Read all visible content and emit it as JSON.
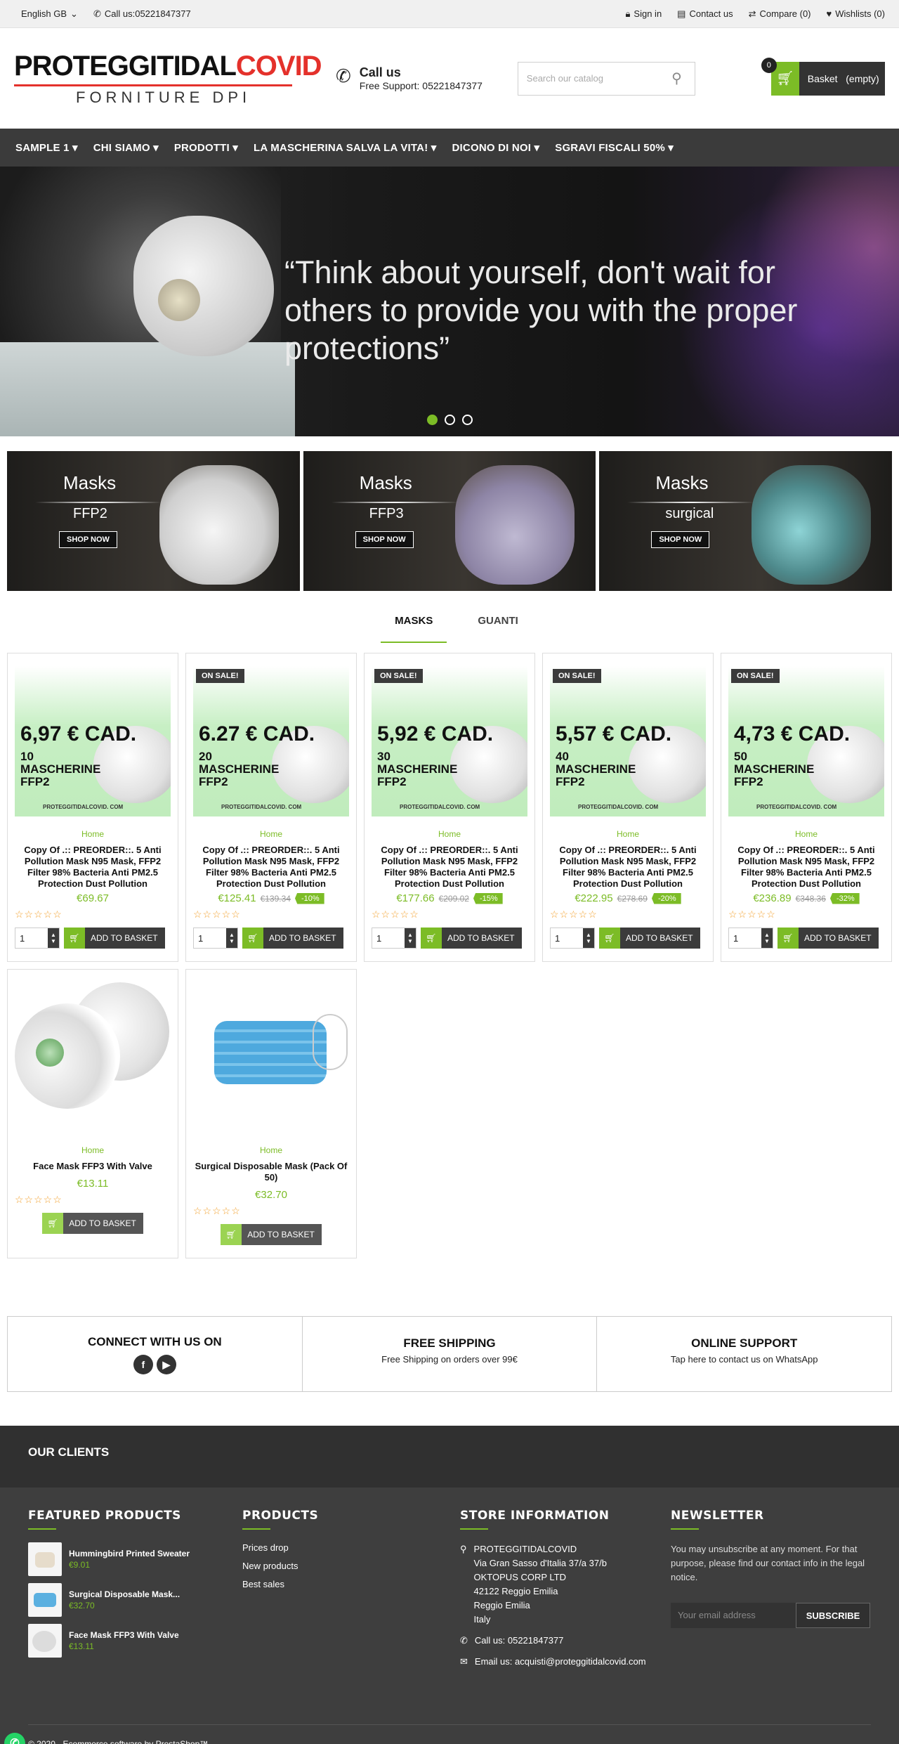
{
  "topbar": {
    "language": "English GB",
    "call": "Call us:05221847377",
    "signin": "Sign in",
    "contact": "Contact us",
    "compare": "Compare (0)",
    "wishlists": "Wishlists (0)"
  },
  "logo": {
    "line1a": "PROTEGGITIDAL",
    "line1b": "COVID",
    "line2": "FORNITURE DPI"
  },
  "header": {
    "call_title": "Call us",
    "call_sub": "Free Support: 05221847377",
    "search_placeholder": "Search our catalog",
    "basket_label": "Basket",
    "basket_state": "(empty)",
    "basket_count": "0"
  },
  "nav": [
    "SAMPLE 1",
    "CHI SIAMO",
    "PRODOTTI",
    "LA MASCHERINA SALVA LA VITA!",
    "DICONO DI NOI",
    "SGRAVI FISCALI 50%"
  ],
  "hero": {
    "quote": "“Think about yourself, don't wait for others to provide you with the proper protections”"
  },
  "banners": [
    {
      "title": "Masks",
      "sub": "FFP2",
      "btn": "SHOP NOW"
    },
    {
      "title": "Masks",
      "sub": "FFP3",
      "btn": "SHOP NOW"
    },
    {
      "title": "Masks",
      "sub": "surgical",
      "btn": "SHOP NOW"
    }
  ],
  "tabs": [
    "MASKS",
    "GUANTI"
  ],
  "products": [
    {
      "onsale": "",
      "promo_price": "6,97 € CAD.",
      "promo_qty1": "10",
      "promo_qty2": "MASCHERINE",
      "promo_qty3": "FFP2",
      "promo_site": "PROTEGGITIDALCOVID. COM",
      "cat": "Home",
      "name": "Copy Of .:: PREORDER::. 5 Anti Pollution Mask N95 Mask, FFP2 Filter 98% Bacteria Anti PM2.5 Protection Dust Pollution",
      "price": "€69.67",
      "old": "",
      "disc": ""
    },
    {
      "onsale": "ON SALE!",
      "promo_price": "6.27 € CAD.",
      "promo_qty1": "20",
      "promo_qty2": "MASCHERINE",
      "promo_qty3": "FFP2",
      "promo_site": "PROTEGGITIDALCOVID. COM",
      "cat": "Home",
      "name": "Copy Of .:: PREORDER::. 5 Anti Pollution Mask N95 Mask, FFP2 Filter 98% Bacteria Anti PM2.5 Protection Dust Pollution",
      "price": "€125.41",
      "old": "€139.34",
      "disc": "-10%"
    },
    {
      "onsale": "ON SALE!",
      "promo_price": "5,92 € CAD.",
      "promo_qty1": "30",
      "promo_qty2": "MASCHERINE",
      "promo_qty3": "FFP2",
      "promo_site": "PROTEGGITIDALCOVID. COM",
      "cat": "Home",
      "name": "Copy Of .:: PREORDER::. 5 Anti Pollution Mask N95 Mask, FFP2 Filter 98% Bacteria Anti PM2.5 Protection Dust Pollution",
      "price": "€177.66",
      "old": "€209.02",
      "disc": "-15%"
    },
    {
      "onsale": "ON SALE!",
      "promo_price": "5,57 € CAD.",
      "promo_qty1": "40",
      "promo_qty2": "MASCHERINE",
      "promo_qty3": "FFP2",
      "promo_site": "PROTEGGITIDALCOVID. COM",
      "cat": "Home",
      "name": "Copy Of .:: PREORDER::. 5 Anti Pollution Mask N95 Mask, FFP2 Filter 98% Bacteria Anti PM2.5 Protection Dust Pollution",
      "price": "€222.95",
      "old": "€278.69",
      "disc": "-20%"
    },
    {
      "onsale": "ON SALE!",
      "promo_price": "4,73 € CAD.",
      "promo_qty1": "50",
      "promo_qty2": "MASCHERINE",
      "promo_qty3": "FFP2",
      "promo_site": "PROTEGGITIDALCOVID. COM",
      "cat": "Home",
      "name": "Copy Of .:: PREORDER::. 5 Anti Pollution Mask N95 Mask, FFP2 Filter 98% Bacteria Anti PM2.5 Protection Dust Pollution",
      "price": "€236.89",
      "old": "€348.36",
      "disc": "-32%"
    },
    {
      "cat": "Home",
      "name": "Face Mask FFP3 With Valve",
      "price": "€13.11"
    },
    {
      "cat": "Home",
      "name": "Surgical Disposable Mask (Pack Of 50)",
      "price": "€32.70"
    }
  ],
  "buy": {
    "qty": "1",
    "add": "ADD TO BASKET"
  },
  "features": [
    {
      "title": "CONNECT WITH US ON",
      "sub": ""
    },
    {
      "title": "FREE SHIPPING",
      "sub": "Free Shipping on orders over 99€"
    },
    {
      "title": "ONLINE SUPPORT",
      "sub": "Tap here to contact us on WhatsApp"
    }
  ],
  "clients": "OUR CLIENTS",
  "footer": {
    "featured_title": "FEATURED PRODUCTS",
    "featured": [
      {
        "name": "Hummingbird Printed Sweater",
        "price": "€9.01"
      },
      {
        "name": "Surgical Disposable Mask...",
        "price": "€32.70"
      },
      {
        "name": "Face Mask FFP3 With Valve",
        "price": "€13.11"
      }
    ],
    "products_title": "PRODUCTS",
    "products_links": [
      "Prices drop",
      "New products",
      "Best sales"
    ],
    "store_title": "STORE INFORMATION",
    "store_lines": [
      "PROTEGGITIDALCOVID",
      "Via Gran Sasso d'Italia 37/a 37/b",
      "OKTOPUS CORP LTD",
      "42122 Reggio Emilia",
      "Reggio Emilia",
      "Italy"
    ],
    "store_call": "Call us: 05221847377",
    "store_email": "Email us: acquisti@proteggitidalcovid.com",
    "newsletter_title": "NEWSLETTER",
    "newsletter_text": "You may unsubscribe at any moment. For that purpose, please find our contact info in the legal notice.",
    "newsletter_placeholder": "Your email address",
    "newsletter_btn": "SUBSCRIBE",
    "copyright": "© 2020 - Ecommerce software by PrestaShop™"
  },
  "colors": {
    "accent": "#7cbc26",
    "dark": "#3b3b3b",
    "brand_red": "#e4312b"
  }
}
